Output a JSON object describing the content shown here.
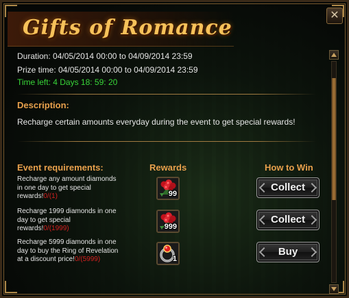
{
  "title": "Gifts of Romance",
  "info": {
    "duration": "Duration: 04/05/2014 00:00 to 04/09/2014 23:59",
    "prize_time": "Prize time: 04/05/2014 00:00 to 04/09/2014 23:59",
    "time_left": "Time left: 4 Days  18: 59: 20"
  },
  "description": {
    "heading": "Description:",
    "text": "Recharge certain amounts everyday during the event to get special rewards!"
  },
  "columns": {
    "requirements": "Event requirements:",
    "rewards": "Rewards",
    "how_to_win": "How to Win"
  },
  "rows": [
    {
      "requirement": "Recharge any amount diamonds in one day to get special rewards!",
      "progress": "0/(1)",
      "reward_icon": "rose-bouquet-icon",
      "reward_count": "99",
      "action": "Collect"
    },
    {
      "requirement": "Recharge 1999 diamonds in one day to get special rewards!",
      "progress": "0/(1999)",
      "reward_icon": "rose-bouquet-icon",
      "reward_count": "999",
      "action": "Collect"
    },
    {
      "requirement": "Recharge 5999 diamonds in one day to buy the Ring of Revelation at a discount price!",
      "progress": "0/(5999)",
      "reward_icon": "ring-icon",
      "reward_count": "1",
      "action": "Buy"
    }
  ],
  "close_symbol": "✕",
  "colors": {
    "title": "#f6c25a",
    "section_heading": "#e8a04c",
    "time_left": "#38d438",
    "progress": "#d42020"
  }
}
